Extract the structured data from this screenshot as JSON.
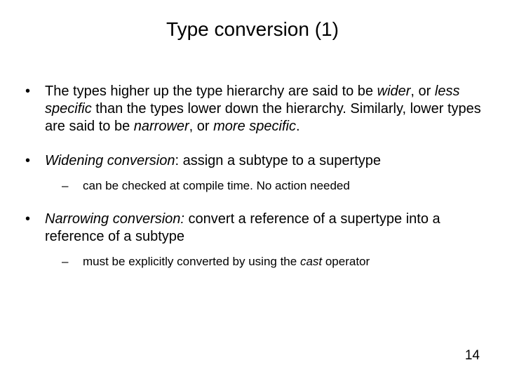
{
  "title": "Type conversion (1)",
  "bullets": {
    "b1": {
      "t1": "The types higher up the type hierarchy are said to be ",
      "wider": "wider",
      "t2": ", or ",
      "less_specific": "less specific",
      "t3": " than the types lower down the hierarchy. Similarly, lower types are said to be ",
      "narrower": "narrower",
      "t4": ", or ",
      "more_specific": "more specific",
      "t5": "."
    },
    "b2": {
      "widening": "Widening conversion",
      "t1": ": assign a subtype to a supertype",
      "sub": "can be checked at compile time. No action needed"
    },
    "b3": {
      "narrowing": "Narrowing conversion:",
      "t1": " convert a reference of a supertype into a reference of a subtype",
      "sub_a": "must be explicitly converted by using the ",
      "cast": "cast",
      "sub_b": " operator"
    }
  },
  "page_number": "14"
}
